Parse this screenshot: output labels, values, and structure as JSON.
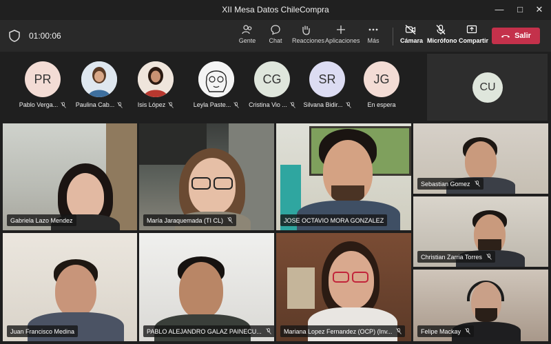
{
  "window": {
    "title": "XII Mesa Datos ChileCompra"
  },
  "toolbar": {
    "timer": "01:00:06",
    "buttons": [
      {
        "label": "Gente",
        "icon": "people-icon"
      },
      {
        "label": "Chat",
        "icon": "chat-icon"
      },
      {
        "label": "Reacciones",
        "icon": "reactions-icon"
      },
      {
        "label": "Aplicaciones",
        "icon": "plus-icon"
      },
      {
        "label": "Más",
        "icon": "more-icon"
      },
      {
        "label": "Cámara",
        "icon": "camera-off-icon"
      },
      {
        "label": "Micrófono",
        "icon": "mic-off-icon"
      },
      {
        "label": "Compartir",
        "icon": "share-icon"
      }
    ],
    "leave_label": "Salir"
  },
  "strip": {
    "people": [
      {
        "initials": "PR",
        "name": "Pablo Verga...",
        "color": "#f3dcd5"
      },
      {
        "initials": "",
        "name": "Paulina Cab...",
        "color": "#c9d6e3"
      },
      {
        "initials": "",
        "name": "Isis López",
        "color": "#e8d7cc"
      },
      {
        "initials": "",
        "name": "Leyla Paste...",
        "color": "#f2f2f2"
      },
      {
        "initials": "CG",
        "name": "Cristina Vio ...",
        "color": "#dfe6dc"
      },
      {
        "initials": "SR",
        "name": "Silvana Bidir...",
        "color": "#dcdcf2"
      },
      {
        "initials": "JG",
        "name": "En espera",
        "color": "#f3dcd5"
      }
    ],
    "overflow": {
      "initials": "CU"
    }
  },
  "tiles": [
    {
      "name": "Gabriela Lazo Mendez",
      "muted": false
    },
    {
      "name": "María Jaraquemada (TI CL)",
      "muted": true
    },
    {
      "name": "JOSE OCTAVIO MORA GONZALEZ",
      "muted": false
    },
    {
      "name": "Sebastian Gomez",
      "muted": true
    },
    {
      "name": "Christian Zarria Torres",
      "muted": true
    },
    {
      "name": "Juan Francisco Medina",
      "muted": false
    },
    {
      "name": "PABLO ALEJANDRO GALAZ PAINECU...",
      "muted": true
    },
    {
      "name": "Mariana Lopez Fernandez (OCP) (Inv...",
      "muted": true
    },
    {
      "name": "Felipe Mackay",
      "muted": true
    }
  ]
}
